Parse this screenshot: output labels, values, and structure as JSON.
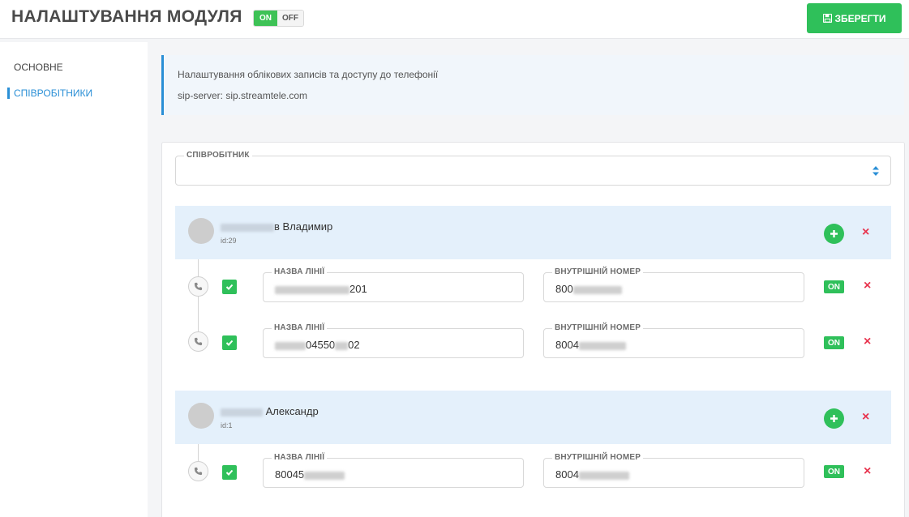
{
  "header": {
    "title": "НАЛАШТУВАННЯ МОДУЛЯ",
    "toggle_on": "ON",
    "toggle_off": "OFF",
    "save_label": "ЗБЕРЕГТИ"
  },
  "sidebar": {
    "items": [
      {
        "label": "ОСНОВНЕ",
        "active": false
      },
      {
        "label": "СПІВРОБІТНИКИ",
        "active": true
      }
    ]
  },
  "info": {
    "line1": "Налаштування облікових записів та доступу до телефонії",
    "line2": "sip-server: sip.streamtele.com"
  },
  "employee_select": {
    "label": "СПІВРОБІТНИК",
    "value": ""
  },
  "employees": [
    {
      "name_visible": "в Владимир",
      "id": "id:29",
      "lines": [
        {
          "line_label": "НАЗВА ЛІНІЇ",
          "line_value": "201",
          "ext_label": "ВНУТРІШНІЙ НОМЕР",
          "ext_value": "800",
          "status": "ON"
        },
        {
          "line_label": "НАЗВА ЛІНІЇ",
          "line_value_a": "04550",
          "line_value_b": "02",
          "ext_label": "ВНУТРІШНІЙ НОМЕР",
          "ext_value": "8004",
          "status": "ON"
        }
      ]
    },
    {
      "name_visible": "Александр",
      "id": "id:1",
      "lines": [
        {
          "line_label": "НАЗВА ЛІНІЇ",
          "line_value": "80045",
          "ext_label": "ВНУТРІШНІЙ НОМЕР",
          "ext_value": "8004",
          "status": "ON"
        }
      ]
    }
  ],
  "colors": {
    "accent_green": "#2fc05a",
    "accent_blue": "#2a8fd6",
    "delete_red": "#e8344e",
    "employee_header_bg": "#e4f0fb"
  },
  "icons": {
    "save": "floppy-disk-icon",
    "select": "sort-arrows-icon",
    "add": "plus-icon",
    "delete": "close-icon",
    "phone": "phone-icon",
    "check": "checkmark-icon"
  }
}
